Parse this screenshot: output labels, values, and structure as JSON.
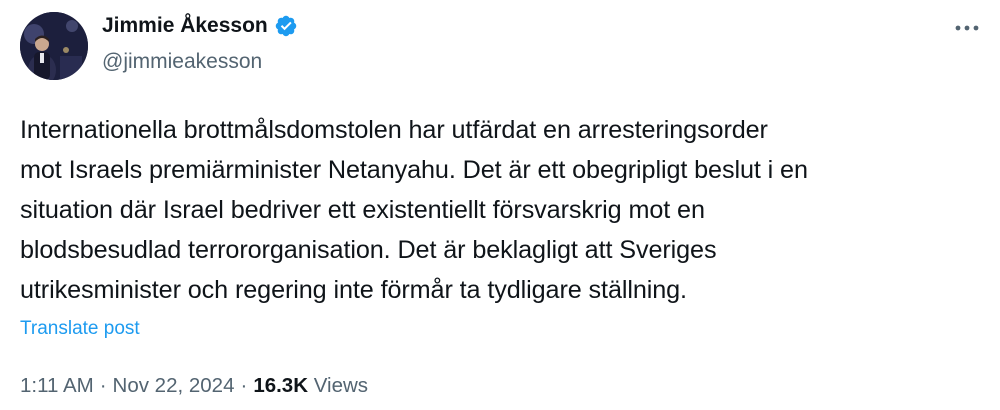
{
  "author": {
    "display_name": "Jimmie Åkesson",
    "handle": "@jimmieakesson",
    "verified": true,
    "verified_color": "#1d9bf0"
  },
  "tweet": {
    "text": "Internationella brottmålsdomstolen har utfärdat en arresteringsorder\nmot Israels premiärminister Netanyahu. Det är ett obegripligt beslut i en\nsituation där Israel bedriver ett existentiellt försvarskrig mot en\nblodsbesudlad terrororganisation. Det är beklagligt att Sveriges\nutrikesminister och regering inte förmår ta tydligare ställning.",
    "translate_label": "Translate post"
  },
  "meta": {
    "time": "1:11 AM",
    "separator": "·",
    "date": "Nov 22, 2024",
    "views_count": "16.3K",
    "views_label": "Views"
  },
  "icons": {
    "more": "more-horizontal-icon",
    "verified": "verified-badge-icon"
  },
  "colors": {
    "text": "#0f1419",
    "secondary": "#536471",
    "link": "#1d9bf0"
  }
}
